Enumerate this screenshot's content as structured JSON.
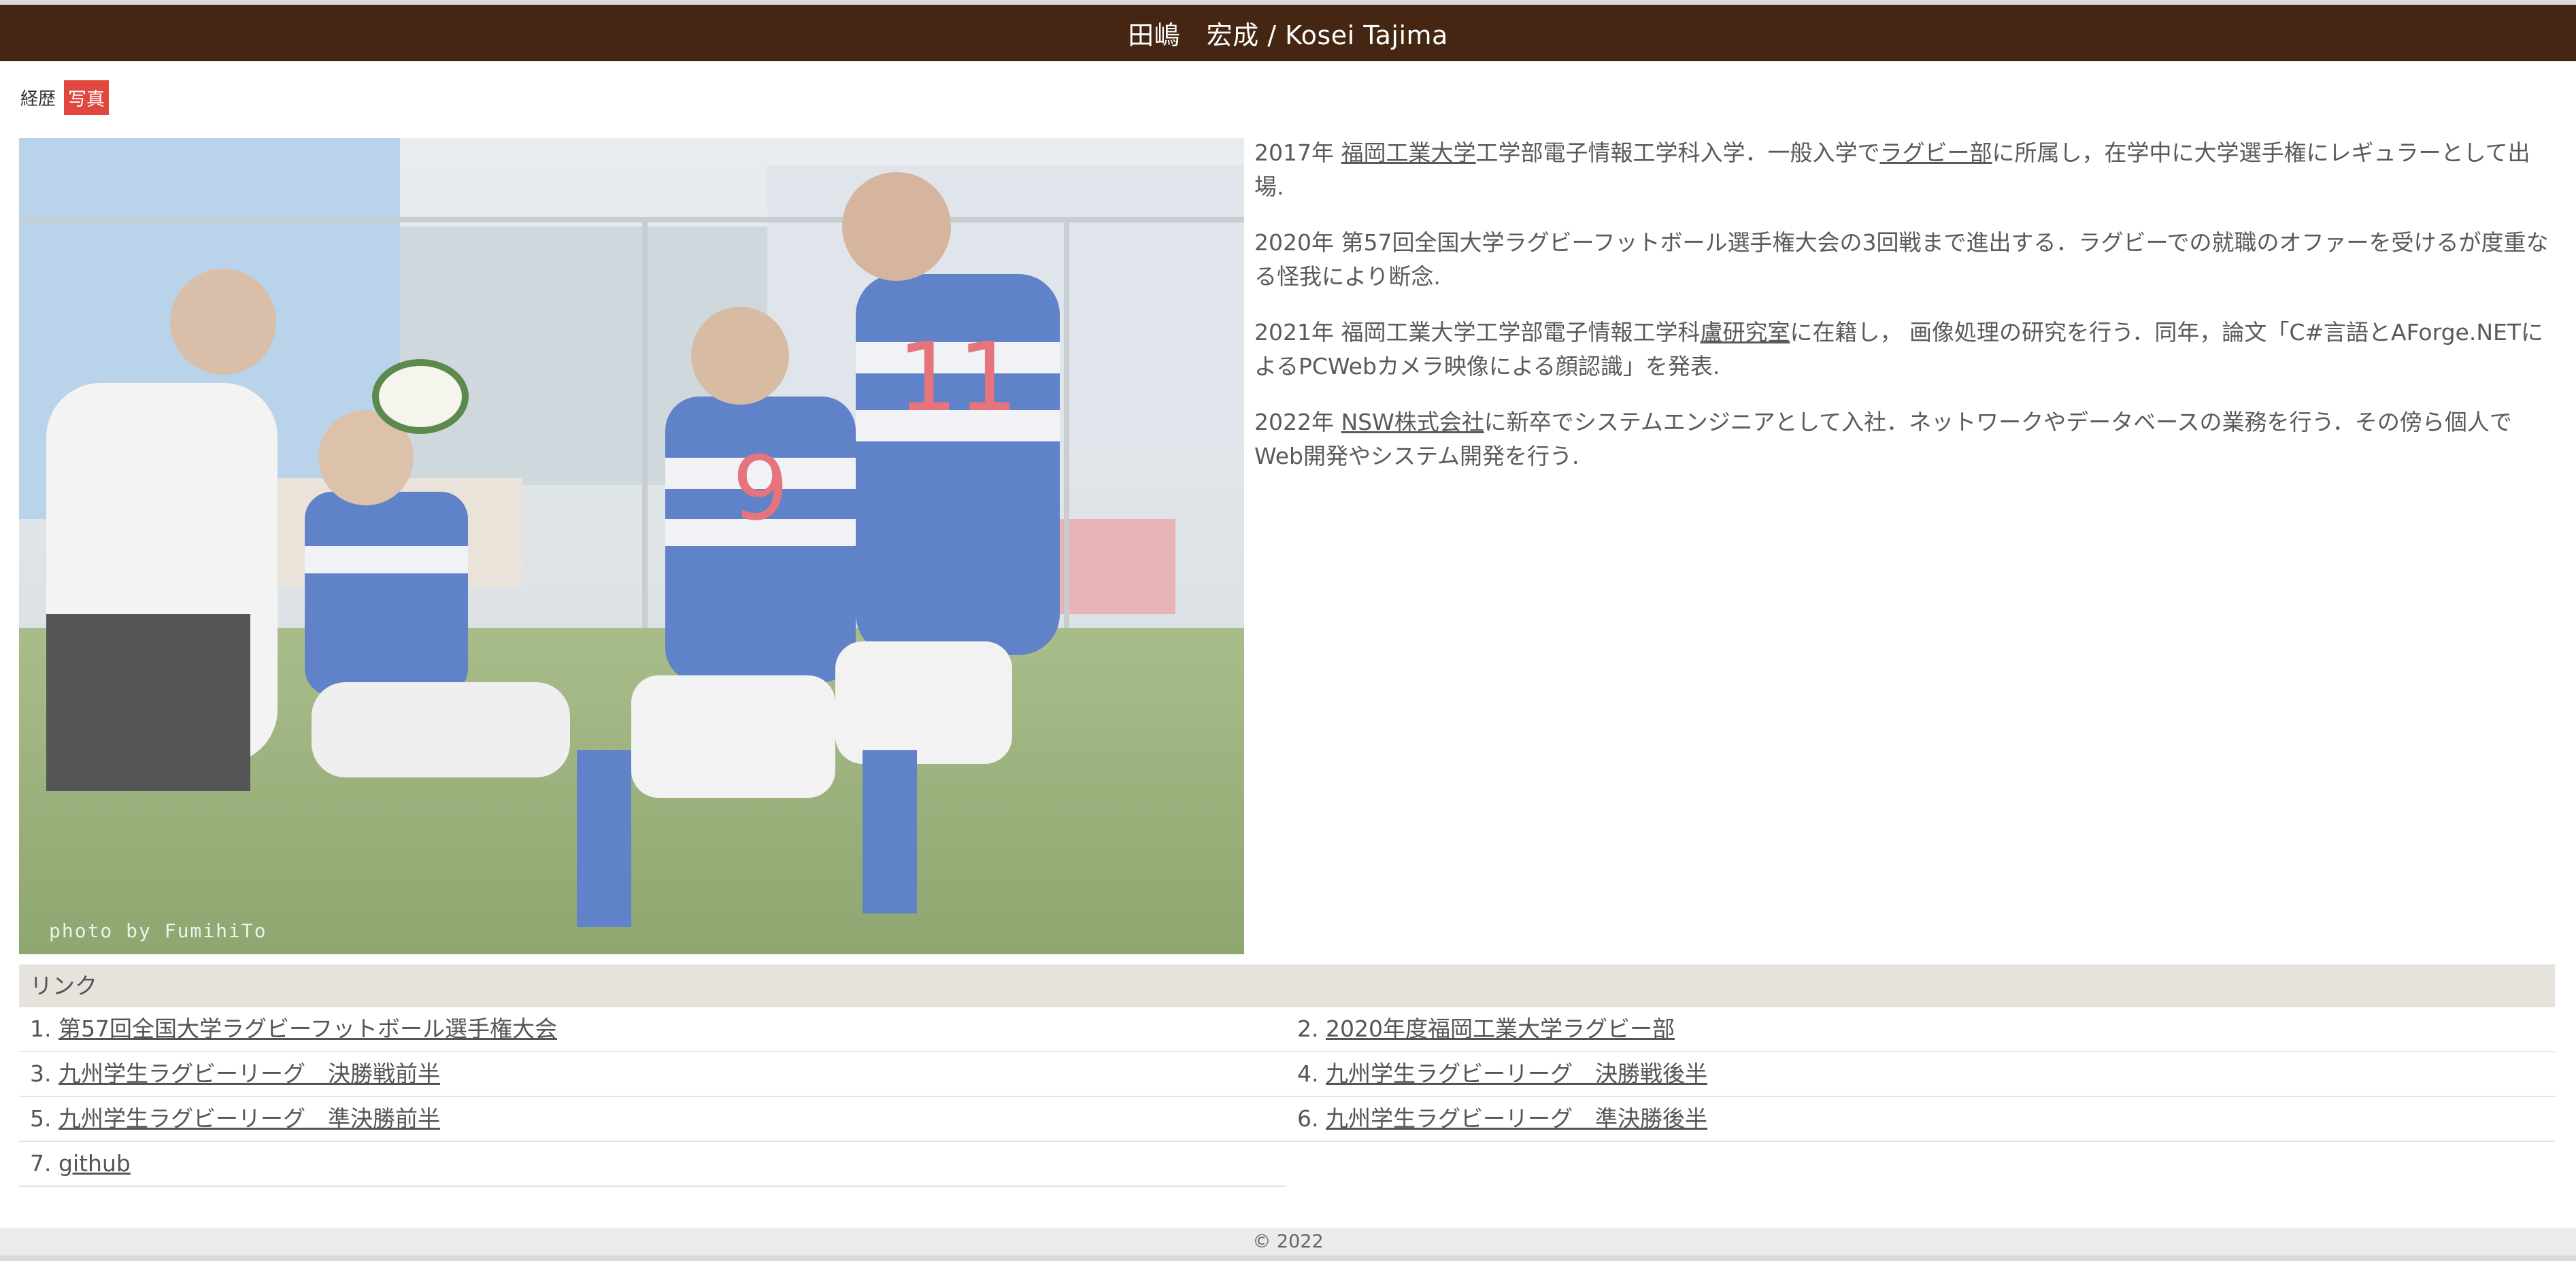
{
  "header": {
    "title": "田嶋　宏成 / Kosei Tajima"
  },
  "tabs": [
    {
      "label": "経歴"
    },
    {
      "label": "写真"
    }
  ],
  "photo": {
    "credit": "photo by FumihiTo"
  },
  "career": [
    {
      "before": "2017年 ",
      "link1": "福岡工業大学",
      "middle": "工学部電子情報工学科入学．一般入学で",
      "link2": "ラグビー部",
      "after": "に所属し，在学中に大学選手権にレギュラーとして出場."
    },
    {
      "text": "2020年 第57回全国大学ラグビーフットボール選手権大会の3回戦まで進出する．ラグビーでの就職のオファーを受けるが度重なる怪我により断念."
    },
    {
      "before": "2021年 福岡工業大学工学部電子情報工学科",
      "link1": "盧研究室",
      "after": "に在籍し， 画像処理の研究を行う．同年，論文「C#言語とAForge.NETによるPCWebカメラ映像による顔認識」を発表."
    },
    {
      "before": "2022年 ",
      "link1": "NSW株式会社",
      "after": "に新卒でシステムエンジニアとして入社．ネットワークやデータベースの業務を行う．その傍ら個人でWeb開発やシステム開発を行う."
    }
  ],
  "links": {
    "header": "リンク",
    "items": [
      {
        "num": "1.",
        "label": "第57回全国大学ラグビーフットボール選手権大会"
      },
      {
        "num": "2.",
        "label": "2020年度福岡工業大学ラグビー部"
      },
      {
        "num": "3.",
        "label": "九州学生ラグビーリーグ　決勝戦前半"
      },
      {
        "num": "4.",
        "label": "九州学生ラグビーリーグ　決勝戦後半"
      },
      {
        "num": "5.",
        "label": "九州学生ラグビーリーグ　準決勝前半"
      },
      {
        "num": "6.",
        "label": "九州学生ラグビーリーグ　準決勝後半"
      },
      {
        "num": "7.",
        "label": "github"
      }
    ]
  },
  "footer": {
    "text": "© 2022"
  }
}
